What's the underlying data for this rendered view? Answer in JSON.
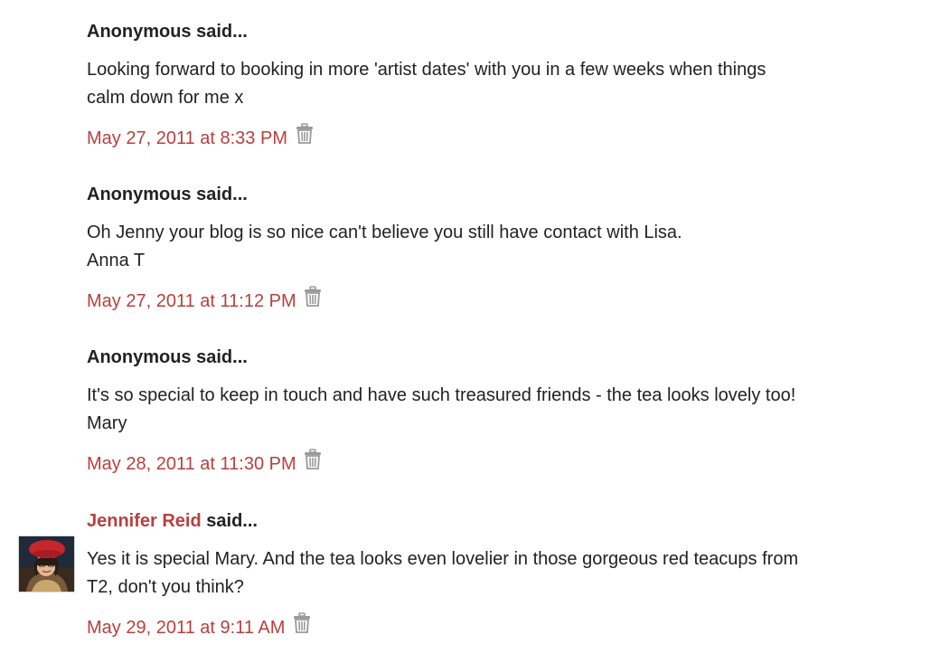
{
  "comments": [
    {
      "author": "Anonymous",
      "said": " said...",
      "body_lines": [
        "Looking forward to booking in more 'artist dates' with you in a few weeks when things",
        "calm down for me x"
      ],
      "timestamp": "May 27, 2011 at 8:33 PM"
    },
    {
      "author": "Anonymous",
      "said": " said...",
      "body_lines": [
        "Oh Jenny your blog is so nice can't believe you still have contact with Lisa.",
        "Anna T"
      ],
      "timestamp": "May 27, 2011 at 11:12 PM"
    },
    {
      "author": "Anonymous",
      "said": " said...",
      "body_lines": [
        "It's so special to keep in touch and have such treasured friends - the tea looks lovely too!",
        "Mary"
      ],
      "timestamp": "May 28, 2011 at 11:30 PM"
    },
    {
      "author": "Jennifer Reid",
      "said": " said...",
      "body_lines": [
        "Yes it is special Mary. And the tea looks even lovelier in those gorgeous red teacups from",
        "T2, don't you think?"
      ],
      "timestamp": "May 29, 2011 at 9:11 AM"
    }
  ],
  "icons": {
    "delete": "trash-icon",
    "avatar": "avatar-photo"
  },
  "colors": {
    "link": "#b7403d",
    "text": "#222222",
    "trash": "#9a9a9a",
    "avatar_hat": "#c8262c",
    "avatar_bg": "#1f2a3a"
  }
}
